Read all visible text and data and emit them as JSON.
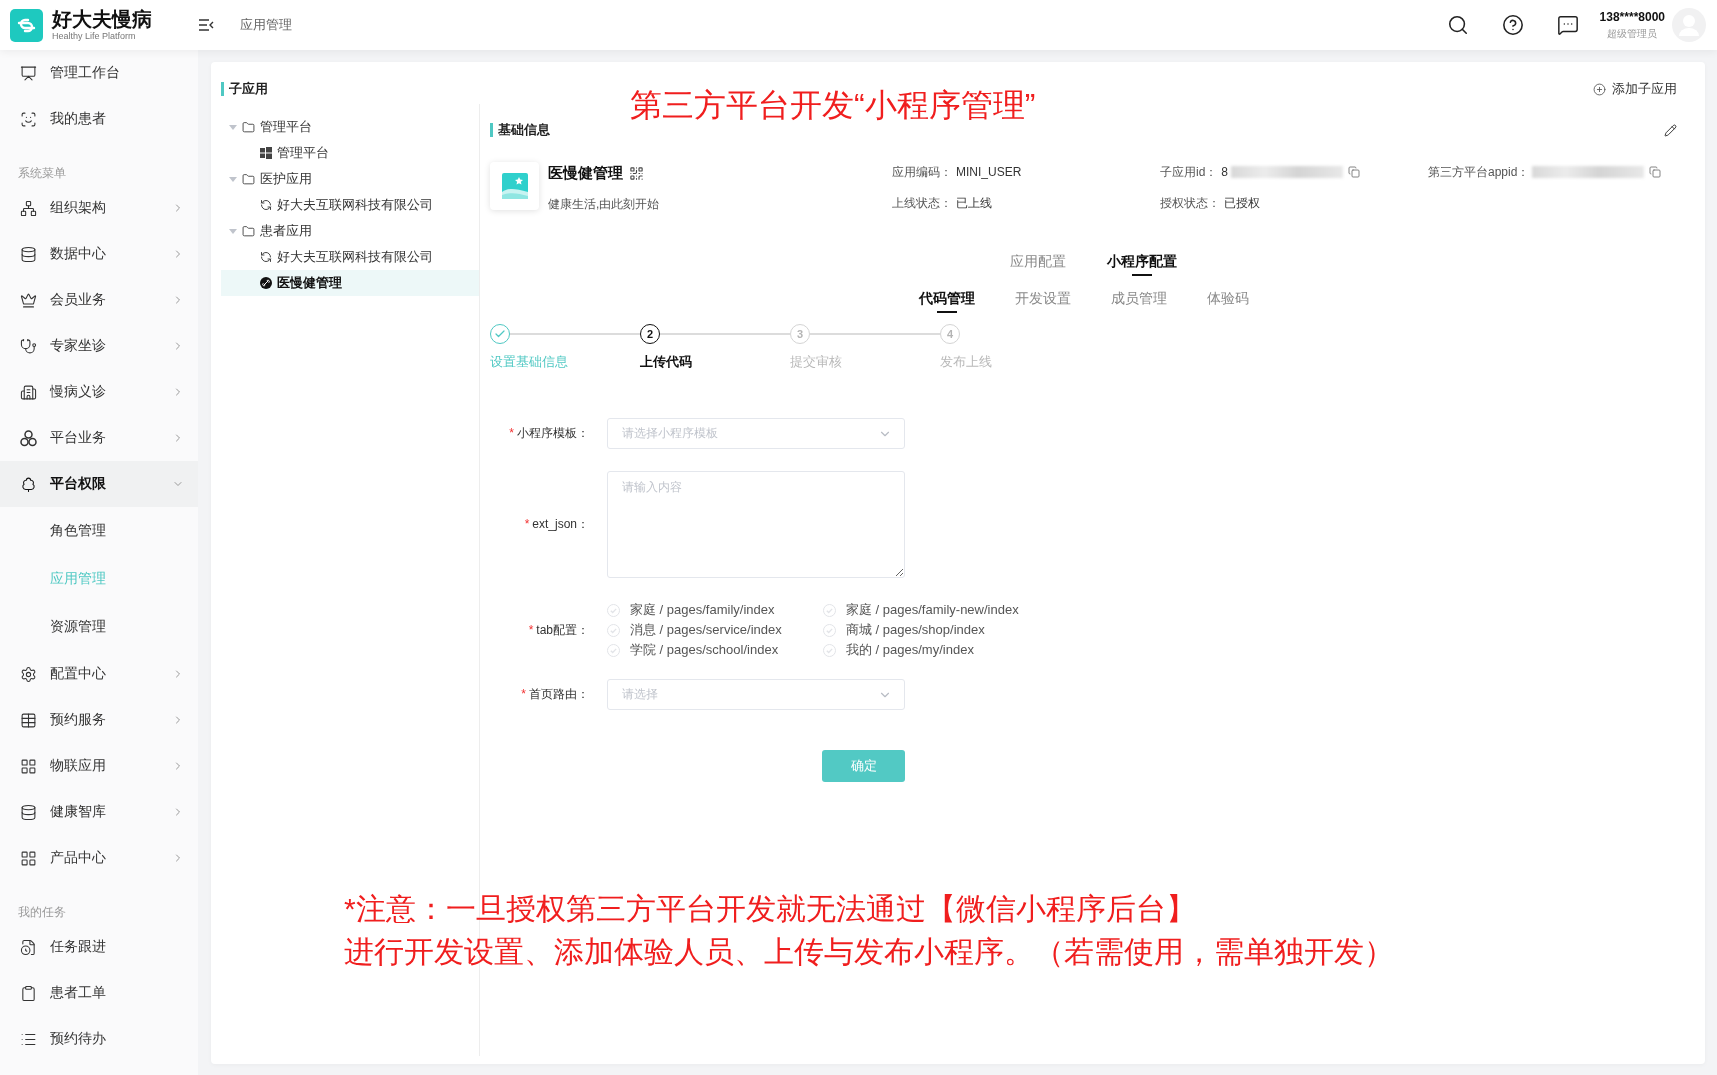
{
  "header": {
    "logo_title": "好大夫慢病",
    "logo_subtitle": "Healthy Life Platform",
    "breadcrumb": "应用管理",
    "user": {
      "phone": "138****8000",
      "role": "超级管理员"
    }
  },
  "sidebar": {
    "groups": [
      {
        "items": [
          {
            "label": "管理工作台",
            "kind": "link",
            "selected": false
          },
          {
            "label": "我的患者",
            "kind": "link",
            "selected": false
          }
        ]
      },
      {
        "title": "系统菜单",
        "items": [
          {
            "label": "组织架构",
            "kind": "submenu",
            "expanded": false
          },
          {
            "label": "数据中心",
            "kind": "submenu",
            "expanded": false
          },
          {
            "label": "会员业务",
            "kind": "submenu",
            "expanded": false
          },
          {
            "label": "专家坐诊",
            "kind": "submenu",
            "expanded": false
          },
          {
            "label": "慢病义诊",
            "kind": "submenu",
            "expanded": false
          },
          {
            "label": "平台业务",
            "kind": "submenu",
            "expanded": false
          },
          {
            "label": "平台权限",
            "kind": "submenu",
            "expanded": true,
            "children": [
              {
                "label": "角色管理",
                "selected": false
              },
              {
                "label": "应用管理",
                "selected": true
              },
              {
                "label": "资源管理",
                "selected": false
              }
            ]
          },
          {
            "label": "配置中心",
            "kind": "submenu",
            "expanded": false
          },
          {
            "label": "预约服务",
            "kind": "submenu",
            "expanded": false
          },
          {
            "label": "物联应用",
            "kind": "submenu",
            "expanded": false
          },
          {
            "label": "健康智库",
            "kind": "submenu",
            "expanded": false
          },
          {
            "label": "产品中心",
            "kind": "submenu",
            "expanded": false
          }
        ]
      },
      {
        "title": "我的任务",
        "items": [
          {
            "label": "任务跟进",
            "kind": "link",
            "selected": false
          },
          {
            "label": "患者工单",
            "kind": "link",
            "selected": false
          },
          {
            "label": "预约待办",
            "kind": "link",
            "selected": false
          }
        ]
      }
    ]
  },
  "sub_apps": {
    "title": "子应用",
    "add_button": "添加子应用",
    "tree": [
      {
        "label": "管理平台",
        "expanded": true,
        "selected": false,
        "children": [
          {
            "label": "管理平台",
            "selected": false
          }
        ]
      },
      {
        "label": "医护应用",
        "expanded": true,
        "selected": false,
        "children": [
          {
            "label": "好大夫互联网科技有限公司",
            "selected": false
          }
        ]
      },
      {
        "label": "患者应用",
        "expanded": true,
        "selected": false,
        "children": [
          {
            "label": "好大夫互联网科技有限公司",
            "selected": false
          },
          {
            "label": "医慢健管理",
            "selected": true
          }
        ]
      }
    ]
  },
  "basic_info": {
    "title": "基础信息",
    "app": {
      "name": "医慢健管理",
      "slogan": "健康生活,由此刻开始"
    },
    "fields": [
      {
        "label": "应用编码：",
        "value": "MINI_USER"
      },
      {
        "label": "子应用id：",
        "value": "8",
        "redacted": true,
        "copyable": true
      },
      {
        "label": "第三方平台appid：",
        "redacted": true,
        "copyable": true
      },
      {
        "label": "上线状态：",
        "value": "已上线"
      },
      {
        "label": "授权状态：",
        "value": "已授权"
      }
    ]
  },
  "config_tabs": [
    {
      "label": "应用配置",
      "selected": false
    },
    {
      "label": "小程序配置",
      "selected": true
    }
  ],
  "code_tabs": [
    {
      "label": "代码管理",
      "selected": true
    },
    {
      "label": "开发设置",
      "selected": false
    },
    {
      "label": "成员管理",
      "selected": false
    },
    {
      "label": "体验码",
      "selected": false
    }
  ],
  "steps": [
    {
      "label": "设置基础信息",
      "completed": true,
      "current": false
    },
    {
      "number": "2",
      "label": "上传代码",
      "completed": false,
      "current": true
    },
    {
      "number": "3",
      "label": "提交审核",
      "completed": false,
      "current": false
    },
    {
      "number": "4",
      "label": "发布上线",
      "completed": false,
      "current": false
    }
  ],
  "form": {
    "required_mark": "*",
    "fields": [
      {
        "kind": "select",
        "label": "小程序模板：",
        "required": true,
        "placeholder": "请选择小程序模板"
      },
      {
        "kind": "textarea",
        "label": "ext_json：",
        "required": true,
        "placeholder": "请输入内容"
      },
      {
        "kind": "checkboxes",
        "label": "tab配置：",
        "required": true,
        "options": [
          {
            "label": "家庭 / pages/family/index",
            "checked": false
          },
          {
            "label": "家庭 / pages/family-new/index",
            "checked": false
          },
          {
            "label": "消息 / pages/service/index",
            "checked": false
          },
          {
            "label": "商城 / pages/shop/index",
            "checked": false
          },
          {
            "label": "学院 / pages/school/index",
            "checked": false
          },
          {
            "label": "我的 / pages/my/index",
            "checked": false
          }
        ]
      },
      {
        "kind": "select",
        "label": "首页路由：",
        "required": true,
        "placeholder": "请选择"
      }
    ],
    "submit": "确定"
  },
  "annotations": [
    {
      "kind": "title",
      "lines": [
        "第三方平台开发“小程序管理”"
      ]
    },
    {
      "kind": "note",
      "lines": [
        "*注意：一旦授权第三方平台开发就无法通过【微信小程序后台】",
        "进行开发设置、添加体验人员、上传与发布小程序。（若需使用，需单独开发）"
      ]
    }
  ]
}
